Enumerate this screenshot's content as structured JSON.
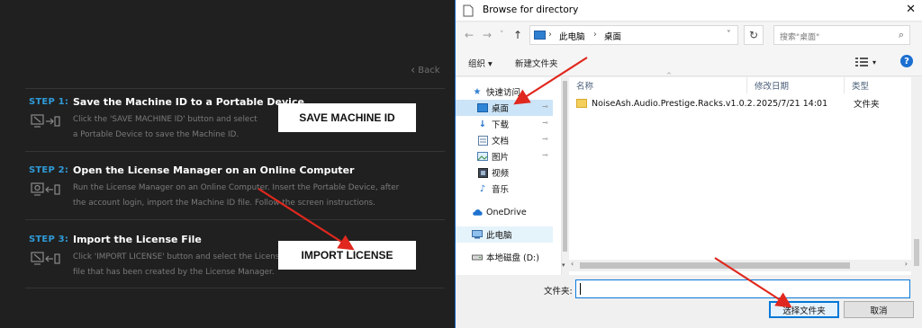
{
  "app": {
    "back_label": "Back",
    "steps": [
      {
        "label": "STEP 1:",
        "title": "Save the Machine ID to a Portable Device",
        "desc": "Click the 'SAVE MACHINE ID' button and select\na Portable Device to save the Machine ID.",
        "button": "SAVE MACHINE ID"
      },
      {
        "label": "STEP 2:",
        "title": "Open  the License Manager   on an Online Computer",
        "desc": "Run the License Manager on an Online Computer. Insert the Portable Device, after\nthe account login, import the Machine ID file. Follow the screen instructions."
      },
      {
        "label": "STEP 3:",
        "title": "Import the License File",
        "desc": "Click 'IMPORT LICENSE' button and select the License\nfile that has been created by the License Manager.",
        "button": "IMPORT LICENSE"
      }
    ]
  },
  "dialog": {
    "title": "Browse for directory",
    "close": "✕",
    "nav": {
      "back": "←",
      "forward": "→",
      "dropdown": "˅",
      "up": "↑"
    },
    "address": {
      "root": "此电脑",
      "sep": "›",
      "current": "桌面",
      "dropdown": "˅"
    },
    "refresh": "↻",
    "search_placeholder": "搜索\"桌面\"",
    "search_icon": "⌕",
    "toolbar": {
      "organize": "组织 ▾",
      "new_folder": "新建文件夹",
      "view_menu": "▾",
      "help": "?"
    },
    "nav_items": [
      {
        "label": "快速访问",
        "icon": "star-icon"
      },
      {
        "label": "桌面",
        "icon": "desktop-icon",
        "pinned": "📌"
      },
      {
        "label": "下载",
        "icon": "download-icon",
        "pinned": "📌"
      },
      {
        "label": "文档",
        "icon": "document-icon",
        "pinned": "📌"
      },
      {
        "label": "图片",
        "icon": "picture-icon",
        "pinned": "📌"
      },
      {
        "label": "视频",
        "icon": "video-icon"
      },
      {
        "label": "音乐",
        "icon": "music-icon"
      },
      {
        "label": "OneDrive",
        "icon": "cloud-icon"
      },
      {
        "label": "此电脑",
        "icon": "pc-icon"
      },
      {
        "label": "本地磁盘 (D:)",
        "icon": "drive-icon"
      }
    ],
    "columns": {
      "name": "名称",
      "date": "修改日期",
      "type": "类型"
    },
    "files": [
      {
        "name": "NoiseAsh.Audio.Prestige.Racks.v1.0.2...",
        "date": "2025/7/21 14:01",
        "type": "文件夹"
      }
    ],
    "folder_label": "文件夹:",
    "folder_value": "",
    "select_button": "选择文件夹",
    "cancel_button": "取消"
  },
  "colors": {
    "app_bg": "#202020",
    "step_accent": "#2f9bd8",
    "annotation_arrow": "#e0281e",
    "selection": "#cce4f7",
    "primary_border": "#0078d7"
  }
}
